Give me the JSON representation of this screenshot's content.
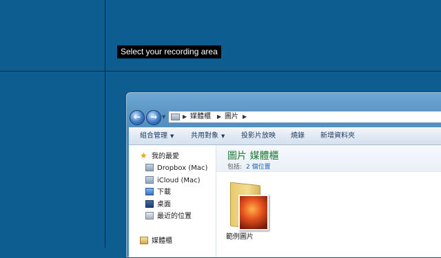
{
  "overlay": {
    "hint": "Select your recording area"
  },
  "explorer": {
    "address": {
      "crumbs": [
        "媒體櫃",
        "圖片"
      ]
    },
    "toolbar": {
      "organize": "組合管理",
      "share": "共用對象",
      "slideshow": "投影片放映",
      "burn": "燒錄",
      "new_folder": "新增資料夾"
    },
    "nav": {
      "favorites": "我的最愛",
      "items": [
        "Dropbox (Mac)",
        "iCloud (Mac)",
        "下載",
        "桌面",
        "最近的位置"
      ],
      "libraries": "媒體櫃"
    },
    "library": {
      "title": "圖片 媒體櫃",
      "includes_label": "包括:",
      "locations": "2 個位置"
    },
    "files": [
      {
        "name": "範例圖片",
        "icon": "sample-pictures-folder-icon"
      }
    ]
  },
  "colors": {
    "desktop": "#0e5d90",
    "library_title": "#1e7a34",
    "link": "#1a5fb4"
  }
}
